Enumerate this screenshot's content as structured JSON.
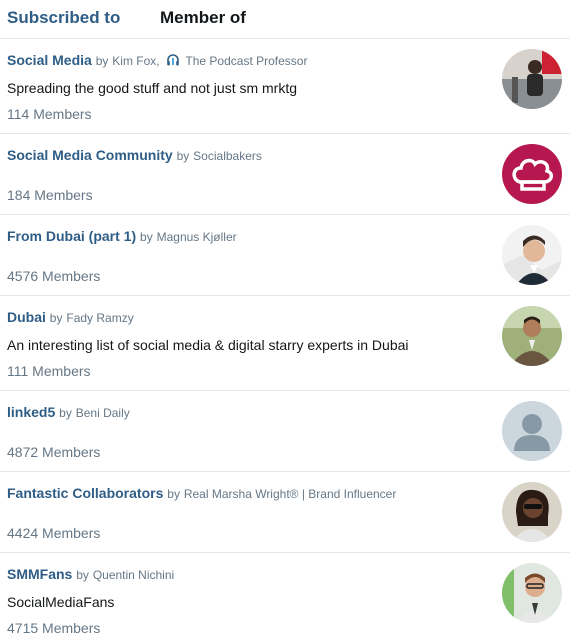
{
  "tabs": {
    "subscribed": "Subscribed to",
    "member": "Member of"
  },
  "by_word": "by",
  "lists": [
    {
      "name": "Social Media",
      "owner": "Kim Fox,",
      "owner_extra": "The Podcast Professor",
      "owner_icon": "headphones-icon",
      "description": "Spreading the good stuff and not just sm mrktg",
      "members": "114 Members"
    },
    {
      "name": "Social Media Community",
      "owner": "Socialbakers",
      "description": "",
      "members": "184 Members"
    },
    {
      "name": "From Dubai (part 1)",
      "owner": "Magnus Kjøller",
      "description": "",
      "members": "4576 Members"
    },
    {
      "name": "Dubai",
      "owner": "Fady Ramzy",
      "description": "An interesting list of social media & digital starry experts in Dubai",
      "members": "111 Members"
    },
    {
      "name": "linked5",
      "owner": "Beni Daily",
      "description": "",
      "members": "4872 Members"
    },
    {
      "name": "Fantastic Collaborators",
      "owner": "Real Marsha Wright® | Brand Influencer",
      "description": "",
      "members": "4424 Members"
    },
    {
      "name": "SMMFans",
      "owner": "Quentin Nichini",
      "description": "SocialMediaFans",
      "members": "4715 Members"
    }
  ],
  "colors": {
    "link": "#2f5d86",
    "muted": "#657786",
    "socialbakers": "#b5174e"
  }
}
